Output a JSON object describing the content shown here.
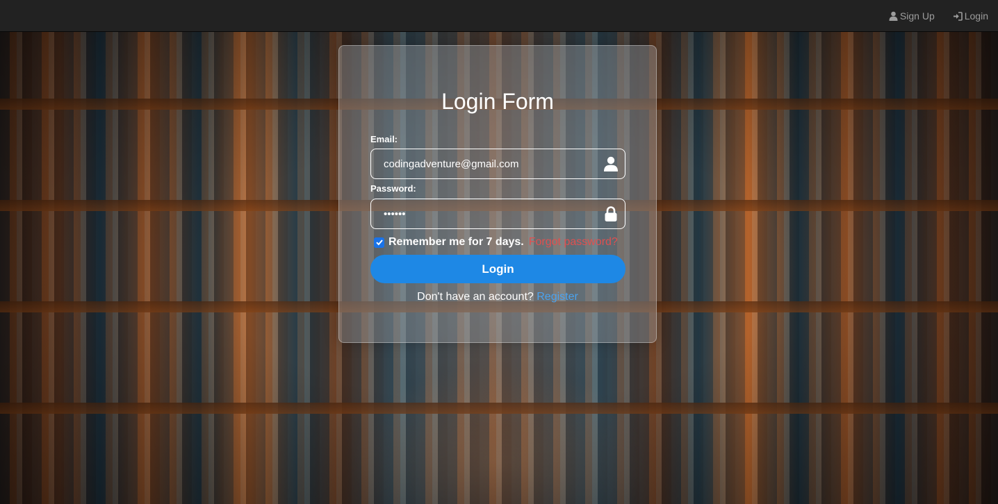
{
  "navbar": {
    "signup_label": "Sign Up",
    "login_label": "Login"
  },
  "form": {
    "title": "Login Form",
    "email_label": "Email:",
    "email_value": "codingadventure@gmail.com",
    "password_label": "Password:",
    "password_value": "••••••",
    "remember_label": "Remember me for 7 days.",
    "remember_checked": true,
    "forgot_label": "Forgot password?",
    "submit_label": "Login",
    "register_prompt": "Don't have an account?",
    "register_label": "Register"
  },
  "icons": {
    "signup": "user-icon",
    "login": "sign-in-icon",
    "email_field": "user-icon",
    "password_field": "lock-icon",
    "checkbox": "checkmark-icon"
  },
  "colors": {
    "navbar_bg": "#222222",
    "nav_text": "#9d9d9d",
    "button_bg": "#1e88e5",
    "checkbox_bg": "#1a73e8",
    "forgot_text": "#e05050",
    "register_text": "#4aa3f0"
  }
}
